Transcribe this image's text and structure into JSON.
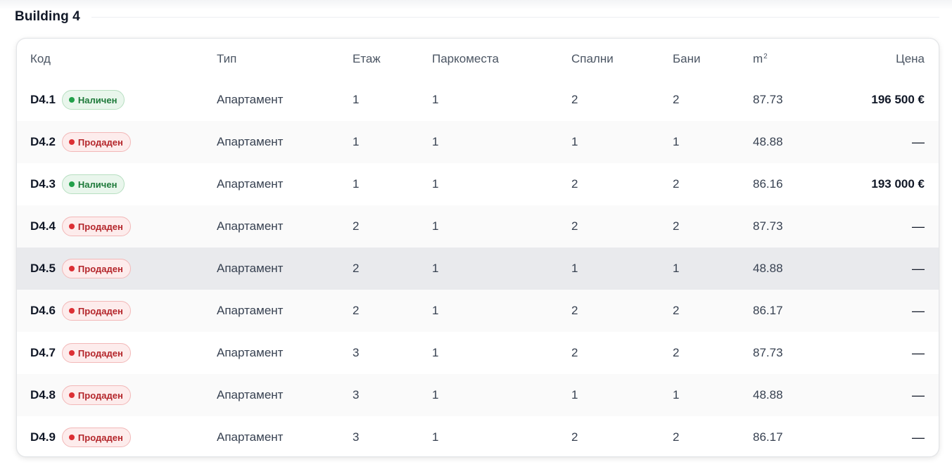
{
  "section": {
    "title": "Building 4"
  },
  "table": {
    "headers": {
      "code": "Код",
      "type": "Тип",
      "floor": "Етаж",
      "parking": "Паркоместа",
      "bedrooms": "Спални",
      "bathrooms": "Бани",
      "area_base": "m",
      "area_sup": "2",
      "price": "Цена"
    },
    "rows": [
      {
        "code": "D4.1",
        "status": "Наличен",
        "status_kind": "available",
        "type": "Апартамент",
        "floor": "1",
        "parking": "1",
        "bedrooms": "2",
        "bathrooms": "2",
        "area": "87.73",
        "price": "196 500 €"
      },
      {
        "code": "D4.2",
        "status": "Продаден",
        "status_kind": "sold",
        "type": "Апартамент",
        "floor": "1",
        "parking": "1",
        "bedrooms": "1",
        "bathrooms": "1",
        "area": "48.88",
        "price": "—"
      },
      {
        "code": "D4.3",
        "status": "Наличен",
        "status_kind": "available",
        "type": "Апартамент",
        "floor": "1",
        "parking": "1",
        "bedrooms": "2",
        "bathrooms": "2",
        "area": "86.16",
        "price": "193 000 €"
      },
      {
        "code": "D4.4",
        "status": "Продаден",
        "status_kind": "sold",
        "type": "Апартамент",
        "floor": "2",
        "parking": "1",
        "bedrooms": "2",
        "bathrooms": "2",
        "area": "87.73",
        "price": "—"
      },
      {
        "code": "D4.5",
        "status": "Продаден",
        "status_kind": "sold",
        "type": "Апартамент",
        "floor": "2",
        "parking": "1",
        "bedrooms": "1",
        "bathrooms": "1",
        "area": "48.88",
        "price": "—"
      },
      {
        "code": "D4.6",
        "status": "Продаден",
        "status_kind": "sold",
        "type": "Апартамент",
        "floor": "2",
        "parking": "1",
        "bedrooms": "2",
        "bathrooms": "2",
        "area": "86.17",
        "price": "—"
      },
      {
        "code": "D4.7",
        "status": "Продаден",
        "status_kind": "sold",
        "type": "Апартамент",
        "floor": "3",
        "parking": "1",
        "bedrooms": "2",
        "bathrooms": "2",
        "area": "87.73",
        "price": "—"
      },
      {
        "code": "D4.8",
        "status": "Продаден",
        "status_kind": "sold",
        "type": "Апартамент",
        "floor": "3",
        "parking": "1",
        "bedrooms": "1",
        "bathrooms": "1",
        "area": "48.88",
        "price": "—"
      },
      {
        "code": "D4.9",
        "status": "Продаден",
        "status_kind": "sold",
        "type": "Апартамент",
        "floor": "3",
        "parking": "1",
        "bedrooms": "2",
        "bathrooms": "2",
        "area": "86.17",
        "price": "—"
      }
    ]
  },
  "colors": {
    "available": "#22a04a",
    "sold": "#dc2f34",
    "hover_row": "#e9eaed"
  },
  "icons": {
    "status_dot": "status-dot-icon"
  }
}
